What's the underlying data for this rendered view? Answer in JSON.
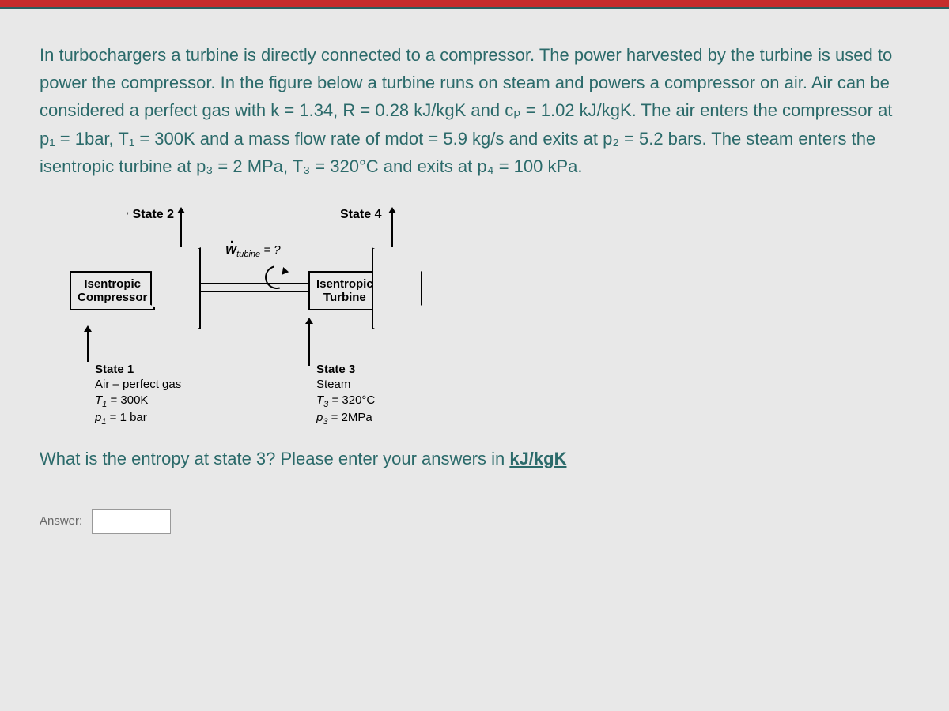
{
  "problem": {
    "paragraph": "In turbochargers a turbine is directly connected to a compressor.  The power harvested by the turbine is used to power the compressor.  In the figure below a turbine runs on steam and powers a compressor on air.  Air can be considered a perfect gas with k = 1.34, R = 0.28 kJ/kgK and cₚ = 1.02 kJ/kgK.  The air enters the compressor at p₁ = 1bar, T₁ = 300K and a mass flow rate of mdot = 5.9 kg/s and exits at p₂ = 5.2 bars.  The steam enters the isentropic turbine at p₃ = 2 MPa, T₃ = 320°C and exits at p₄ = 100 kPa."
  },
  "diagram": {
    "state2_label": "State 2",
    "state4_label": "State 4",
    "w_label_main": "W",
    "w_label_sub": "tubine",
    "w_label_eq": " = ?",
    "compressor_line1": "Isentropic",
    "compressor_line2": "Compressor",
    "turbine_line1": "Isentropic",
    "turbine_line2": "Turbine",
    "state1": {
      "title": "State 1",
      "line2": "Air – perfect gas",
      "line3_var": "T",
      "line3_sub": "1",
      "line3_val": " = 300K",
      "line4_var": "p",
      "line4_sub": "1",
      "line4_val": " = 1 bar"
    },
    "state3": {
      "title": "State 3",
      "line2": "Steam",
      "line3_var": "T",
      "line3_sub": "3",
      "line3_val": " = 320°C",
      "line4_var": "p",
      "line4_sub": "3",
      "line4_val": " = 2MPa"
    }
  },
  "question": {
    "prompt": "What is the entropy at state 3? Please enter your answers in ",
    "units": "kJ/kgK"
  },
  "answer": {
    "label": "Answer:",
    "value": ""
  }
}
